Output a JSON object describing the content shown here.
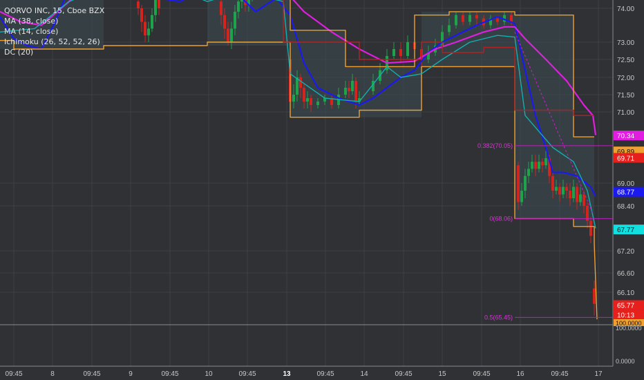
{
  "legend": {
    "title": "QORVO INC, 15, Cboe BZX",
    "ma38": "MA (38, close)",
    "ma14": "MA (14, close)",
    "ichimoku": "Ichimoku (26, 52, 52, 26)",
    "dc": "DC (20)"
  },
  "chart_data": {
    "type": "line",
    "title": "QORVO INC, 15, Cboe BZX",
    "x_labels": [
      "09:45",
      "8",
      "09:45",
      "9",
      "09:45",
      "10",
      "09:45",
      "13",
      "09:45",
      "14",
      "09:45",
      "15",
      "09:45",
      "16",
      "09:45",
      "17"
    ],
    "y_ticks": [
      74.0,
      73.0,
      72.5,
      72.0,
      71.5,
      71.0,
      69.0,
      68.4,
      67.2,
      66.6,
      66.1
    ],
    "ylim": [
      65.5,
      74.3
    ],
    "price_labels": [
      {
        "value": 70.34,
        "text": "70.34",
        "color": "#e01ee0"
      },
      {
        "value": 69.89,
        "text": "69.89",
        "color": "#f0a030"
      },
      {
        "value": 69.71,
        "text": "69.71",
        "color": "#e6201c"
      },
      {
        "value": 68.77,
        "text": "68.77",
        "color": "#1a1af0"
      },
      {
        "value": 67.77,
        "text": "67.77",
        "color": "#12e0e0"
      },
      {
        "value": 65.77,
        "text": "65.77",
        "color": "#e6201c"
      }
    ],
    "countdown": "10:13",
    "fib_levels": [
      {
        "text": "0.382(70.05)",
        "value": 70.05
      },
      {
        "text": "0(68.06)",
        "value": 68.06
      },
      {
        "text": "0.5(65.45)",
        "value": 65.45
      }
    ],
    "sub_pane": {
      "ticks": [
        "100.0000",
        "0.0000"
      ],
      "value_text": "100.0000"
    },
    "series": [
      {
        "name": "MA (14, close)",
        "color": "#1a1af0",
        "points": [
          [
            0,
            73.75
          ],
          [
            20,
            73.1
          ],
          [
            40,
            72.9
          ],
          [
            60,
            72.8
          ],
          [
            80,
            73.6
          ],
          [
            100,
            74.6
          ],
          [
            120,
            75.4
          ],
          [
            140,
            75.8
          ],
          [
            200,
            75.6
          ],
          [
            230,
            74.3
          ],
          [
            260,
            74.2
          ],
          [
            300,
            74.6
          ],
          [
            340,
            74.5
          ],
          [
            370,
            73.9
          ],
          [
            400,
            74.3
          ],
          [
            420,
            73.8
          ],
          [
            440,
            72.4
          ],
          [
            460,
            71.7
          ],
          [
            490,
            71.4
          ],
          [
            520,
            71.2
          ],
          [
            540,
            71.4
          ],
          [
            560,
            71.7
          ],
          [
            580,
            72.0
          ],
          [
            600,
            72.2
          ],
          [
            620,
            72.7
          ],
          [
            640,
            73.0
          ],
          [
            660,
            73.2
          ],
          [
            690,
            73.5
          ],
          [
            720,
            73.75
          ],
          [
            745,
            73.55
          ],
          [
            760,
            72.2
          ],
          [
            775,
            70.9
          ],
          [
            790,
            70.0
          ],
          [
            800,
            69.3
          ],
          [
            815,
            69.3
          ],
          [
            835,
            69.2
          ],
          [
            855,
            68.9
          ],
          [
            862,
            68.65
          ]
        ]
      },
      {
        "name": "MA (38, close)",
        "color": "#e01ee0",
        "points": [
          [
            0,
            73.9
          ],
          [
            30,
            73.6
          ],
          [
            60,
            73.5
          ],
          [
            100,
            74.2
          ],
          [
            160,
            75.3
          ],
          [
            230,
            74.9
          ],
          [
            300,
            74.9
          ],
          [
            350,
            75.1
          ],
          [
            400,
            74.8
          ],
          [
            440,
            73.9
          ],
          [
            480,
            73.3
          ],
          [
            520,
            72.8
          ],
          [
            560,
            72.4
          ],
          [
            600,
            72.45
          ],
          [
            630,
            72.8
          ],
          [
            660,
            73.0
          ],
          [
            700,
            73.3
          ],
          [
            730,
            73.45
          ],
          [
            745,
            73.45
          ],
          [
            760,
            73.1
          ],
          [
            790,
            72.5
          ],
          [
            820,
            71.9
          ],
          [
            845,
            71.2
          ],
          [
            858,
            70.9
          ],
          [
            862,
            70.35
          ]
        ]
      },
      {
        "name": "DC (20) upper",
        "color": "#f0a030",
        "step": true,
        "points": [
          [
            0,
            74.4
          ],
          [
            150,
            74.4
          ],
          [
            150,
            76
          ],
          [
            300,
            76
          ],
          [
            300,
            74.4
          ],
          [
            420,
            74.4
          ],
          [
            420,
            73.35
          ],
          [
            500,
            73.35
          ],
          [
            500,
            72.3
          ],
          [
            600,
            72.3
          ],
          [
            600,
            73.8
          ],
          [
            650,
            73.8
          ],
          [
            650,
            73.9
          ],
          [
            745,
            73.9
          ],
          [
            745,
            73.8
          ],
          [
            830,
            73.8
          ],
          [
            830,
            70.3
          ],
          [
            860,
            70.3
          ]
        ]
      },
      {
        "name": "DC (20) lower",
        "color": "#f0a030",
        "step": true,
        "points": [
          [
            0,
            73.05
          ],
          [
            20,
            73.05
          ],
          [
            20,
            72.8
          ],
          [
            150,
            72.8
          ],
          [
            150,
            72.9
          ],
          [
            300,
            72.9
          ],
          [
            300,
            73.0
          ],
          [
            420,
            73.0
          ],
          [
            420,
            70.85
          ],
          [
            520,
            70.85
          ],
          [
            520,
            71.05
          ],
          [
            610,
            71.05
          ],
          [
            610,
            72.3
          ],
          [
            745,
            72.3
          ],
          [
            745,
            68.06
          ],
          [
            830,
            68.06
          ],
          [
            830,
            67.85
          ],
          [
            860,
            67.85
          ],
          [
            860,
            67.4
          ],
          [
            864,
            65.4
          ]
        ]
      },
      {
        "name": "Ichimoku conversion",
        "color": "#12b0b0",
        "points": [
          [
            0,
            73.3
          ],
          [
            50,
            73.4
          ],
          [
            100,
            74.2
          ],
          [
            200,
            75.0
          ],
          [
            300,
            74.2
          ],
          [
            350,
            74.5
          ],
          [
            410,
            74.2
          ],
          [
            420,
            72.1
          ],
          [
            470,
            71.4
          ],
          [
            520,
            71.3
          ],
          [
            540,
            71.8
          ],
          [
            560,
            72.3
          ],
          [
            580,
            72.0
          ],
          [
            610,
            72.1
          ],
          [
            640,
            72.5
          ],
          [
            680,
            73.0
          ],
          [
            720,
            73.2
          ],
          [
            745,
            73.15
          ],
          [
            760,
            70.9
          ],
          [
            800,
            70.0
          ],
          [
            830,
            69.6
          ],
          [
            850,
            68.8
          ],
          [
            862,
            67.8
          ]
        ]
      },
      {
        "name": "Ichimoku base",
        "color": "#b32222",
        "step": true,
        "points": [
          [
            300,
            74.45
          ],
          [
            410,
            74.45
          ],
          [
            410,
            73.0
          ],
          [
            520,
            73.0
          ],
          [
            520,
            72.5
          ],
          [
            610,
            72.5
          ],
          [
            610,
            73.0
          ],
          [
            640,
            73.0
          ],
          [
            640,
            72.7
          ],
          [
            700,
            72.7
          ],
          [
            700,
            72.85
          ],
          [
            745,
            72.85
          ],
          [
            745,
            71.05
          ],
          [
            830,
            71.05
          ],
          [
            830,
            70.9
          ],
          [
            860,
            70.9
          ]
        ]
      }
    ],
    "candles": [
      [
        200,
        74.2,
        74.0,
        74.6,
        73.8
      ],
      [
        205,
        74.0,
        73.6,
        74.1,
        73.3
      ],
      [
        210,
        73.6,
        73.2,
        73.8,
        73.0
      ],
      [
        215,
        73.2,
        73.4,
        73.6,
        73.0
      ],
      [
        220,
        73.4,
        73.8,
        74.0,
        73.3
      ],
      [
        225,
        73.8,
        74.3,
        74.5,
        73.6
      ],
      [
        230,
        74.3,
        74.0,
        74.6,
        73.8
      ],
      [
        320,
        74.2,
        73.8,
        74.4,
        73.5
      ],
      [
        325,
        73.8,
        73.4,
        74.0,
        73.1
      ],
      [
        330,
        73.4,
        73.0,
        73.6,
        72.9
      ],
      [
        335,
        73.0,
        73.4,
        73.6,
        72.8
      ],
      [
        340,
        73.4,
        73.9,
        74.1,
        73.2
      ],
      [
        345,
        73.9,
        74.2,
        74.5,
        73.7
      ],
      [
        350,
        74.2,
        74.4,
        74.6,
        74.0
      ],
      [
        355,
        74.4,
        74.1,
        74.5,
        73.9
      ],
      [
        360,
        74.1,
        74.3,
        74.4,
        73.9
      ],
      [
        365,
        74.3,
        74.5,
        74.7,
        74.2
      ],
      [
        420,
        72.5,
        71.3,
        72.7,
        71.0
      ],
      [
        425,
        71.3,
        71.5,
        71.8,
        71.1
      ],
      [
        430,
        71.5,
        72.0,
        72.2,
        71.3
      ],
      [
        435,
        72.0,
        71.7,
        72.1,
        71.4
      ],
      [
        440,
        71.7,
        71.3,
        71.8,
        71.1
      ],
      [
        445,
        71.3,
        71.4,
        71.6,
        71.1
      ],
      [
        450,
        71.4,
        71.2,
        71.5,
        71.0
      ],
      [
        460,
        71.2,
        71.3,
        71.4,
        71.1
      ],
      [
        470,
        71.3,
        71.4,
        71.5,
        71.2
      ],
      [
        480,
        71.4,
        71.2,
        71.5,
        71.1
      ],
      [
        490,
        71.2,
        71.5,
        71.7,
        71.1
      ],
      [
        500,
        71.5,
        71.7,
        71.9,
        71.4
      ],
      [
        505,
        71.7,
        71.6,
        71.9,
        71.4
      ],
      [
        510,
        71.6,
        71.9,
        72.1,
        71.5
      ],
      [
        515,
        71.9,
        71.3,
        72.0,
        71.1
      ],
      [
        520,
        71.3,
        71.4,
        71.6,
        71.2
      ],
      [
        540,
        71.6,
        71.9,
        72.1,
        71.5
      ],
      [
        550,
        71.9,
        72.2,
        72.4,
        71.8
      ],
      [
        560,
        72.2,
        72.6,
        72.8,
        72.1
      ],
      [
        570,
        72.6,
        72.8,
        73.0,
        72.5
      ],
      [
        580,
        72.8,
        72.6,
        73.0,
        72.4
      ],
      [
        590,
        72.6,
        73.0,
        73.2,
        72.5
      ],
      [
        600,
        73.0,
        72.8,
        73.2,
        72.6
      ],
      [
        610,
        72.8,
        72.5,
        72.9,
        72.3
      ],
      [
        620,
        72.5,
        72.7,
        72.9,
        72.4
      ],
      [
        630,
        72.7,
        72.9,
        73.1,
        72.6
      ],
      [
        640,
        72.9,
        73.3,
        73.5,
        72.8
      ],
      [
        650,
        73.3,
        73.5,
        73.7,
        73.2
      ],
      [
        660,
        73.5,
        73.8,
        73.9,
        73.4
      ],
      [
        670,
        73.8,
        73.6,
        73.9,
        73.5
      ],
      [
        680,
        73.6,
        73.8,
        73.9,
        73.5
      ],
      [
        690,
        73.8,
        73.7,
        73.9,
        73.5
      ],
      [
        700,
        73.7,
        73.5,
        73.8,
        73.4
      ],
      [
        710,
        73.5,
        73.7,
        73.8,
        73.4
      ],
      [
        720,
        73.7,
        73.6,
        73.8,
        73.5
      ],
      [
        730,
        73.6,
        73.8,
        73.9,
        73.5
      ],
      [
        740,
        73.8,
        73.6,
        73.9,
        73.5
      ],
      [
        750,
        69.5,
        68.5,
        69.6,
        68.3
      ],
      [
        755,
        68.5,
        68.8,
        69.0,
        68.4
      ],
      [
        760,
        68.8,
        69.2,
        69.4,
        68.6
      ],
      [
        765,
        69.2,
        69.4,
        69.6,
        69.0
      ],
      [
        770,
        69.4,
        69.6,
        69.8,
        69.3
      ],
      [
        775,
        69.6,
        69.4,
        69.8,
        69.2
      ],
      [
        780,
        69.4,
        69.6,
        69.8,
        69.3
      ],
      [
        785,
        69.6,
        69.5,
        69.7,
        69.3
      ],
      [
        790,
        69.5,
        69.7,
        69.9,
        69.4
      ],
      [
        795,
        69.7,
        69.2,
        69.8,
        69.0
      ],
      [
        800,
        69.2,
        68.8,
        69.3,
        68.6
      ],
      [
        805,
        68.8,
        68.9,
        69.1,
        68.7
      ],
      [
        810,
        68.9,
        68.7,
        69.0,
        68.5
      ],
      [
        815,
        68.7,
        68.9,
        69.1,
        68.6
      ],
      [
        820,
        68.9,
        68.8,
        69.0,
        68.6
      ],
      [
        825,
        68.8,
        68.6,
        69.0,
        68.4
      ],
      [
        830,
        68.6,
        68.9,
        69.1,
        68.5
      ],
      [
        835,
        68.9,
        68.5,
        69.0,
        68.3
      ],
      [
        840,
        68.5,
        68.7,
        68.9,
        68.4
      ],
      [
        845,
        68.7,
        68.4,
        68.8,
        68.2
      ],
      [
        850,
        68.4,
        68.0,
        68.5,
        67.8
      ],
      [
        855,
        68.0,
        67.6,
        68.1,
        67.4
      ],
      [
        860,
        66.2,
        65.8,
        66.4,
        65.5
      ]
    ]
  }
}
